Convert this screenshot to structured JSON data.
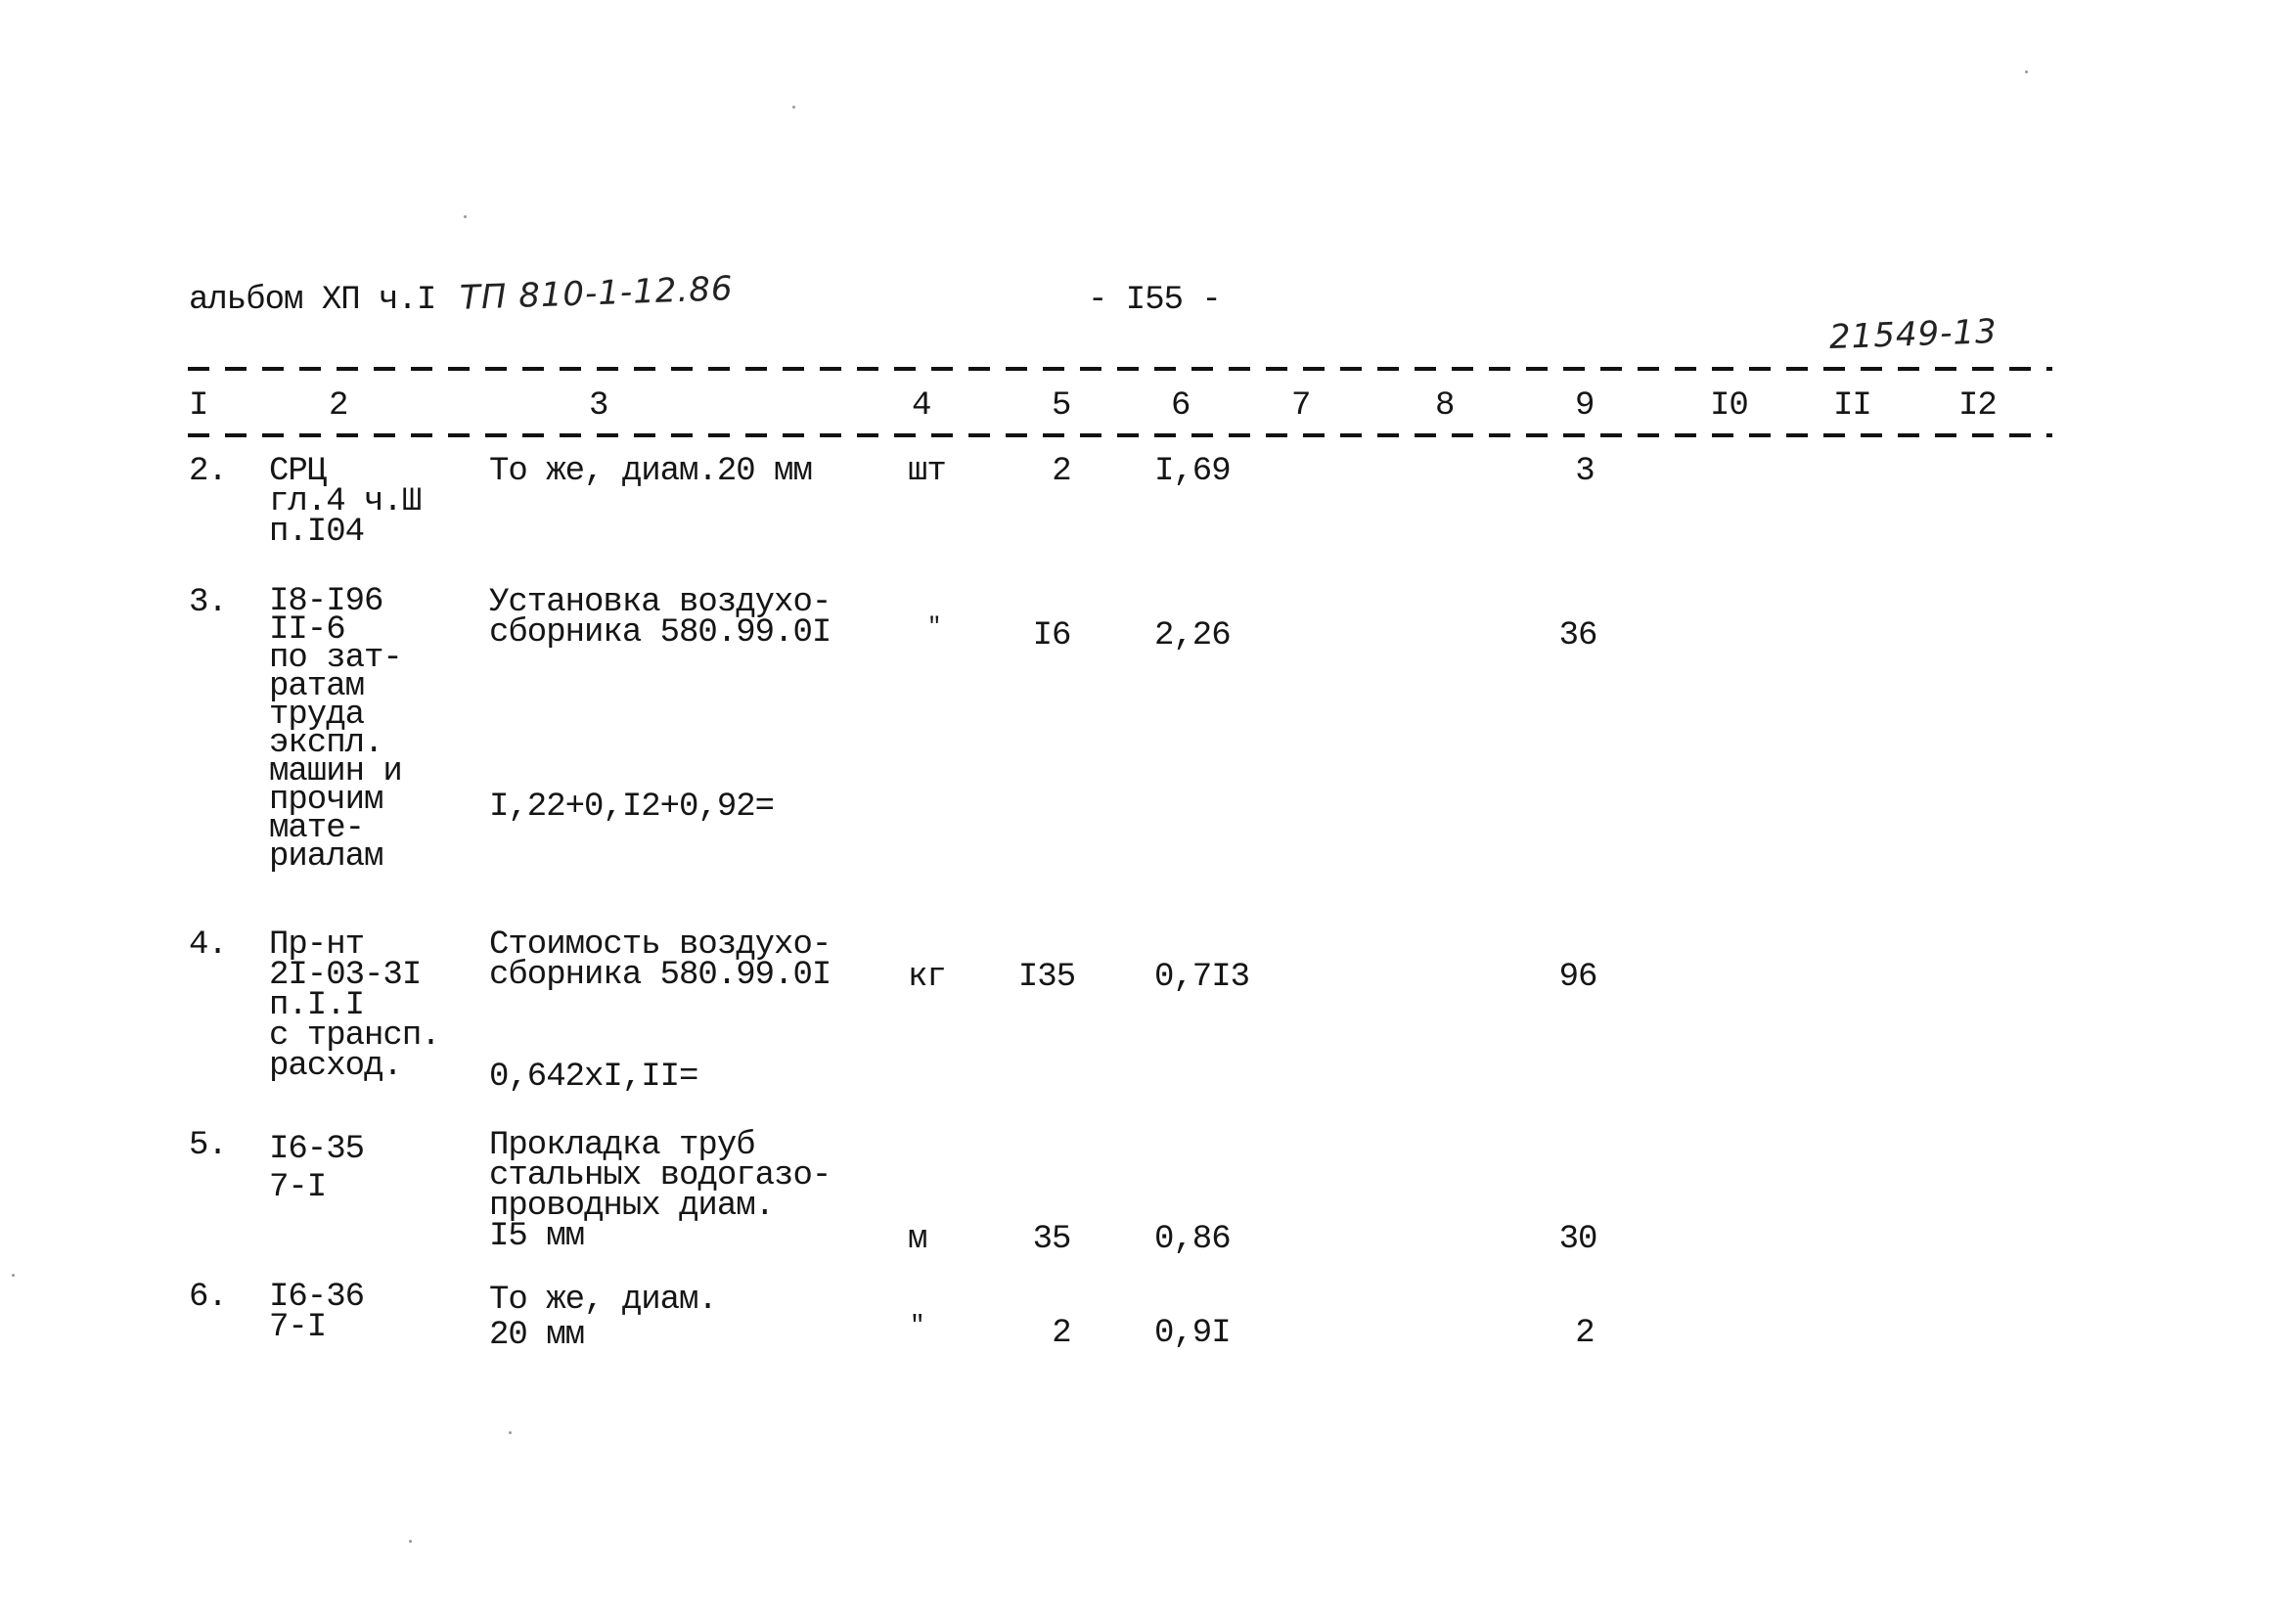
{
  "header": {
    "album": "альбом ХП ч.I",
    "handwritten_ref": "ТП 810-1-12.86",
    "page_number": "- I55 -",
    "handwritten_code": "21549-13"
  },
  "columns": [
    "I",
    "2",
    "3",
    "4",
    "5",
    "6",
    "7",
    "8",
    "9",
    "I0",
    "II",
    "I2"
  ],
  "rows": [
    {
      "num": "2.",
      "ref": "СРЦ\nгл.4 ч.Ш\nп.I04",
      "desc": "То же, диам.20 мм",
      "calc": "",
      "unit": "шт",
      "qty": "2",
      "price": "I,69",
      "total": "3"
    },
    {
      "num": "3.",
      "ref": "I8-I96\nII-6\nпо зат-\nратам\nтруда\nэкспл.\nмашин и\nпрочим\nмате-\nриалам",
      "desc": "Установка воздухо-\nсборника 580.99.0I",
      "calc": "I,22+0,I2+0,92=",
      "unit": "\"",
      "qty": "I6",
      "price": "2,26",
      "total": "36"
    },
    {
      "num": "4.",
      "ref": "Пр-нт\n2I-03-3I\nп.I.I\nс трансп.\nрасход.",
      "desc": "Стоимость воздухо-\nсборника 580.99.0I",
      "calc": "0,642хI,II=",
      "unit": "кг",
      "qty": "I35",
      "price": "0,7I3",
      "total": "96"
    },
    {
      "num": "5.",
      "ref": "I6-35\n7-I",
      "desc": "Прокладка труб\nстальных водогазо-\nпроводных диам.\nI5 мм",
      "calc": "",
      "unit": "м",
      "qty": "35",
      "price": "0,86",
      "total": "30"
    },
    {
      "num": "6.",
      "ref": "I6-36\n7-I",
      "desc": "То же, диам.\n20 мм",
      "calc": "",
      "unit": "\"",
      "qty": "2",
      "price": "0,9I",
      "total": "2"
    }
  ]
}
